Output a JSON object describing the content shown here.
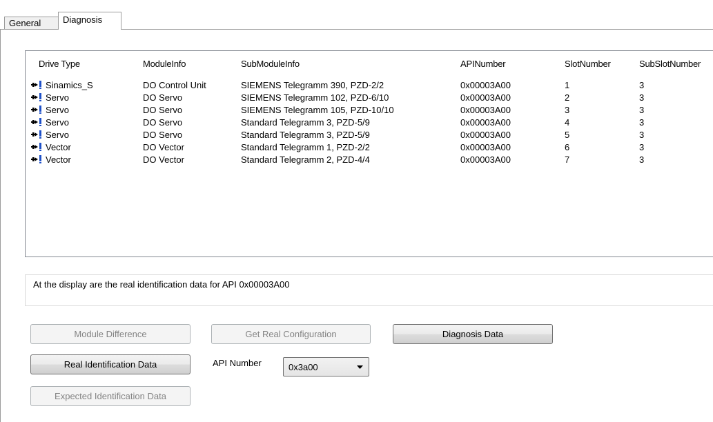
{
  "tabs": [
    {
      "label": "General",
      "active": false
    },
    {
      "label": "Diagnosis",
      "active": true
    }
  ],
  "table": {
    "columns": [
      "Drive Type",
      "ModuleInfo",
      "SubModuleInfo",
      "APINumber",
      "SlotNumber",
      "SubSlotNumber"
    ],
    "rows": [
      [
        "Sinamics_S",
        "DO Control Unit",
        "SIEMENS Telegramm 390, PZD-2/2",
        "0x00003A00",
        "1",
        "3"
      ],
      [
        "Servo",
        "DO Servo",
        "SIEMENS Telegramm 102, PZD-6/10",
        "0x00003A00",
        "2",
        "3"
      ],
      [
        "Servo",
        "DO Servo",
        "SIEMENS Telegramm 105, PZD-10/10",
        "0x00003A00",
        "3",
        "3"
      ],
      [
        "Servo",
        "DO Servo",
        "Standard Telegramm 3, PZD-5/9",
        "0x00003A00",
        "4",
        "3"
      ],
      [
        "Servo",
        "DO Servo",
        "Standard Telegramm 3, PZD-5/9",
        "0x00003A00",
        "5",
        "3"
      ],
      [
        "Vector",
        "DO Vector",
        "Standard Telegramm 1, PZD-2/2",
        "0x00003A00",
        "6",
        "3"
      ],
      [
        "Vector",
        "DO Vector",
        "Standard Telegramm 2, PZD-4/4",
        "0x00003A00",
        "7",
        "3"
      ]
    ],
    "row_icon": "drive-icon"
  },
  "status_text": "At the display are the real identification data for API 0x00003A00",
  "buttons": {
    "module_difference": {
      "label": "Module Difference",
      "enabled": false
    },
    "get_real_configuration": {
      "label": "Get Real Configuration",
      "enabled": false
    },
    "diagnosis_data": {
      "label": "Diagnosis Data",
      "enabled": true
    },
    "real_identification_data": {
      "label": "Real Identification Data",
      "enabled": true
    },
    "expected_identification_data": {
      "label": "Expected Identification Data",
      "enabled": false
    }
  },
  "api_number": {
    "label": "API Number",
    "value": "0x3a00"
  },
  "colors": {
    "accent_icon": "#1e50c8",
    "disabled_text": "#838383"
  }
}
